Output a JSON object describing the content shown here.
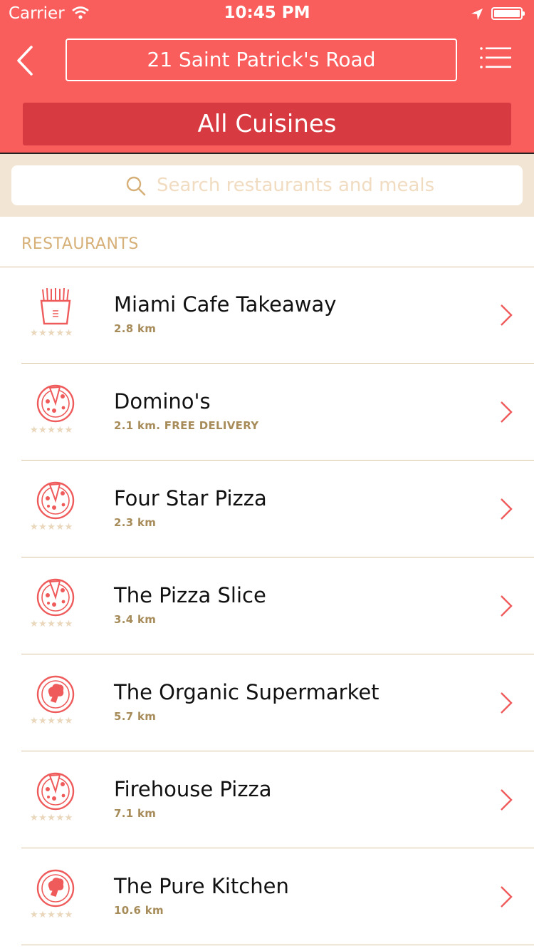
{
  "status_bar": {
    "carrier": "Carrier",
    "time": "10:45 PM"
  },
  "header": {
    "address": "21 Saint Patrick's Road",
    "cuisine_button": "All Cuisines"
  },
  "search": {
    "placeholder": "Search restaurants and meals"
  },
  "section_title": "RESTAURANTS",
  "restaurants": [
    {
      "name": "Miami Cafe Takeaway",
      "meta": "2.8 km",
      "icon": "fries-icon",
      "stars": "★★★★★"
    },
    {
      "name": "Domino's",
      "meta": "2.1 km. FREE DELIVERY",
      "icon": "pizza-icon",
      "stars": "★★★★★"
    },
    {
      "name": "Four Star Pizza",
      "meta": "2.3 km",
      "icon": "pizza-icon",
      "stars": "★★★★★"
    },
    {
      "name": "The Pizza Slice",
      "meta": "3.4 km",
      "icon": "pizza-icon",
      "stars": "★★★★★"
    },
    {
      "name": "The Organic Supermarket",
      "meta": "5.7 km",
      "icon": "broccoli-icon",
      "stars": "★★★★★"
    },
    {
      "name": "Firehouse Pizza",
      "meta": "7.1 km",
      "icon": "pizza-icon",
      "stars": "★★★★★"
    },
    {
      "name": "The Pure Kitchen",
      "meta": "10.6 km",
      "icon": "broccoli-icon",
      "stars": "★★★★★"
    }
  ],
  "colors": {
    "header": "#f95e5d",
    "cuisine_button": "#d83a42",
    "search_band": "#f2e5d3",
    "section_title": "#d6b078",
    "accent": "#ef5b5b"
  }
}
